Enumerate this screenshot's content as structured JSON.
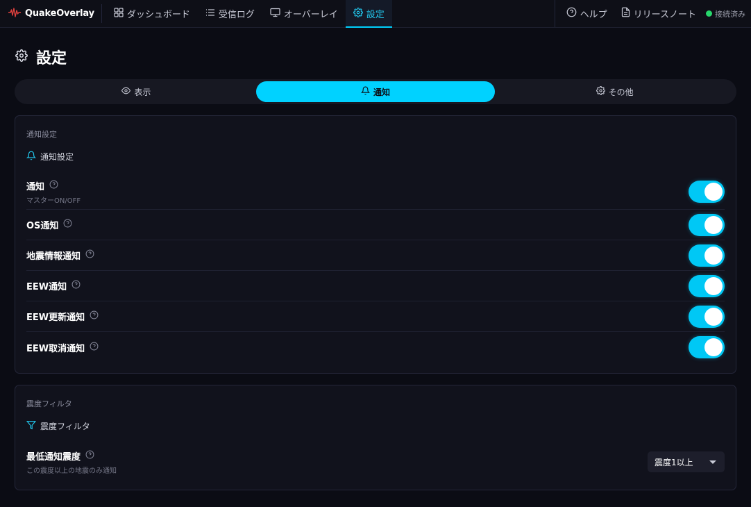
{
  "app": {
    "name": "QuakeOverlay"
  },
  "nav": {
    "items": [
      {
        "label": "ダッシュボード",
        "icon": "dashboard-icon"
      },
      {
        "label": "受信ログ",
        "icon": "list-icon"
      },
      {
        "label": "オーバーレイ",
        "icon": "monitor-icon"
      },
      {
        "label": "設定",
        "icon": "gear-icon",
        "active": true
      }
    ],
    "help_label": "ヘルプ",
    "release_notes_label": "リリースノート",
    "status_label": "接続済み",
    "status_color": "#27d66b"
  },
  "page": {
    "title": "設定"
  },
  "tabs": [
    {
      "label": "表示",
      "icon": "eye-icon"
    },
    {
      "label": "通知",
      "icon": "bell-icon",
      "active": true
    },
    {
      "label": "その他",
      "icon": "gear-icon"
    }
  ],
  "notify_section": {
    "caption": "通知設定",
    "heading": "通知設定",
    "rows": [
      {
        "title": "通知",
        "sub": "マスターON/OFF",
        "enabled": true
      },
      {
        "title": "OS通知",
        "enabled": true
      },
      {
        "title": "地震情報通知",
        "enabled": true
      },
      {
        "title": "EEW通知",
        "enabled": true
      },
      {
        "title": "EEW更新通知",
        "enabled": true
      },
      {
        "title": "EEW取消通知",
        "enabled": true
      }
    ]
  },
  "filter_section": {
    "caption": "震度フィルタ",
    "heading": "震度フィルタ",
    "row": {
      "title": "最低通知震度",
      "sub": "この震度以上の地震のみ通知"
    },
    "select": {
      "value": "震度1以上"
    }
  },
  "colors": {
    "accent": "#00d2ff",
    "background": "#0b0c14",
    "card": "#11121c"
  }
}
